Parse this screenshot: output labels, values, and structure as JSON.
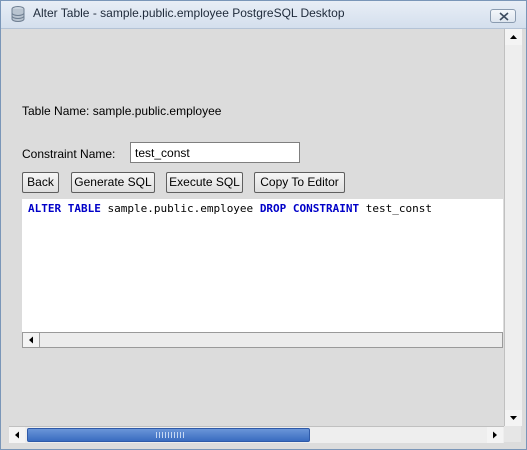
{
  "window": {
    "title": "Alter Table - sample.public.employee PostgreSQL Desktop",
    "close_icon": "close-icon",
    "app_icon": "database-icon"
  },
  "form": {
    "table_name_label": "Table Name: sample.public.employee",
    "constraint_label": "Constraint Name:",
    "constraint_value": "test_const"
  },
  "buttons": {
    "back": "Back",
    "generate": "Generate SQL",
    "execute": "Execute SQL",
    "copy": "Copy To Editor"
  },
  "sql": {
    "kw1": "ALTER TABLE",
    "text1": " sample.public.employee ",
    "kw2": "DROP CONSTRAINT",
    "text2": " test_const"
  },
  "colors": {
    "keyword": "#0000c8",
    "scroll_thumb": "#3a6cc0"
  }
}
